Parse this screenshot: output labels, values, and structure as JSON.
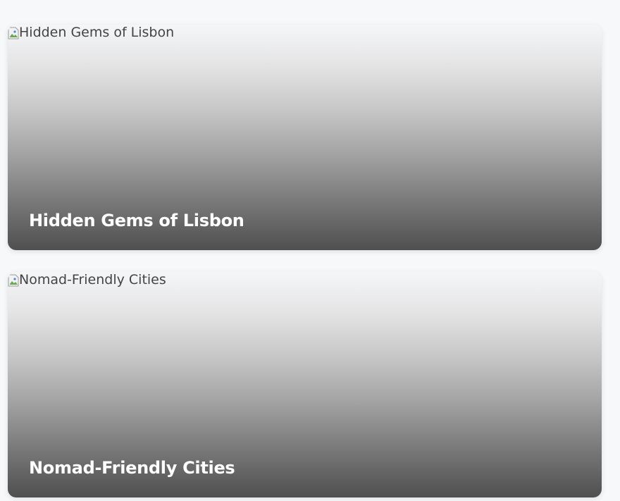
{
  "cards": [
    {
      "image_alt": "Hidden Gems of Lisbon",
      "title": "Hidden Gems of Lisbon"
    },
    {
      "image_alt": "Nomad-Friendly Cities",
      "title": "Nomad-Friendly Cities"
    }
  ],
  "icons": {
    "broken_image": "broken-image-icon"
  }
}
